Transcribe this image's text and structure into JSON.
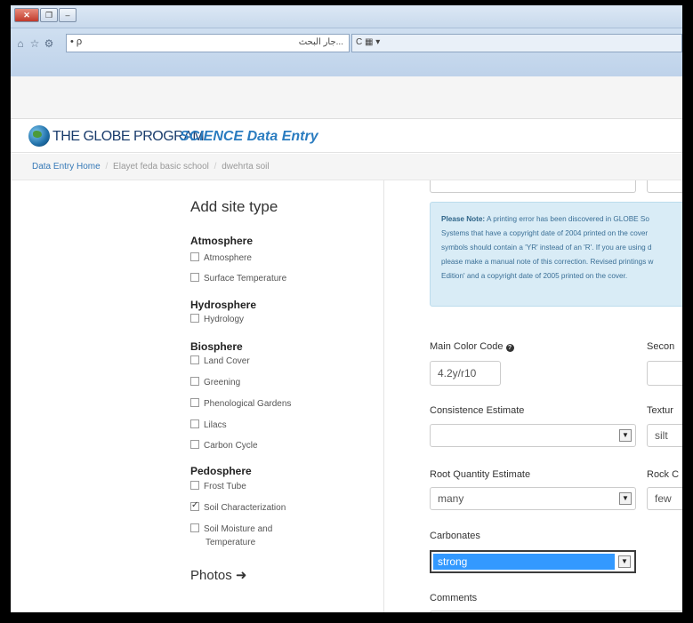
{
  "browser": {
    "close_label": "✕",
    "address_search": "• ρ",
    "address_text": "...جار البحث",
    "tab_icons": "C ▦ ▾"
  },
  "site": {
    "brand": "THE GLOBE PROGRAM",
    "brand_sub": "SCIENCE Data Entry"
  },
  "breadcrumb": {
    "home": "Data Entry Home",
    "school": "Elayet feda basic school",
    "site": "dwehrta soil",
    "separator": "/"
  },
  "sidebar": {
    "title": "Add site type",
    "groups": [
      {
        "name": "Atmosphere",
        "items": [
          {
            "label": "Atmosphere",
            "checked": false
          },
          {
            "label": "Surface Temperature",
            "checked": false
          }
        ]
      },
      {
        "name": "Hydrosphere",
        "items": [
          {
            "label": "Hydrology",
            "checked": false
          }
        ]
      },
      {
        "name": "Biosphere",
        "items": [
          {
            "label": "Land Cover",
            "checked": false
          },
          {
            "label": "Greening",
            "checked": false
          },
          {
            "label": "Phenological Gardens",
            "checked": false
          },
          {
            "label": "Lilacs",
            "checked": false
          },
          {
            "label": "Carbon Cycle",
            "checked": false
          }
        ]
      },
      {
        "name": "Pedosphere",
        "items": [
          {
            "label": "Frost Tube",
            "checked": false
          },
          {
            "label": "Soil Characterization",
            "checked": true
          },
          {
            "label": "Soil Moisture and",
            "checked": false
          }
        ]
      }
    ],
    "soil_moisture_line2": "Temperature",
    "photos": "Photos ➜"
  },
  "note": {
    "bold": "Please Note:",
    "line1": " A printing error has been discovered in GLOBE So",
    "line2": "Systems that have a copyright date of 2004 printed on the cover",
    "line3": "symbols should contain a 'YR' instead of an 'R'. If you are using d",
    "line4": "please make a manual note of this correction. Revised printings w",
    "line5": "Edition' and a copyright date of 2005 printed on the cover."
  },
  "form": {
    "main_color_label": "Main Color Code",
    "main_color_value": "4.2y/r10",
    "secondary_label": "Secon",
    "consistence_label": "Consistence Estimate",
    "consistence_value": "",
    "texture_label": "Textur",
    "texture_value": "silt",
    "root_label": "Root Quantity Estimate",
    "root_value": "many",
    "rock_label": "Rock C",
    "rock_value": "few",
    "carbonates_label": "Carbonates",
    "carbonates_value": "strong",
    "comments_label": "Comments"
  }
}
